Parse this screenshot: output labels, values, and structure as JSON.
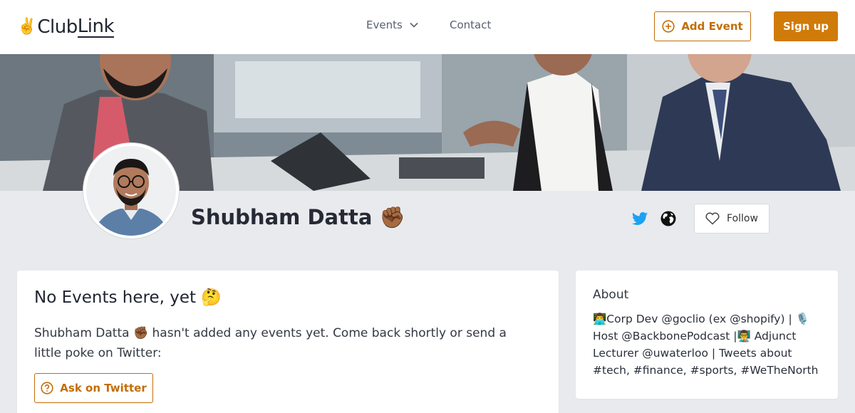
{
  "header": {
    "logo_emoji": "✌️",
    "logo_club": "Club",
    "logo_link": "Link",
    "nav_events": "Events",
    "nav_contact": "Contact",
    "add_event_label": "Add Event",
    "signup_label": "Sign up",
    "accent_color": "#d07a09"
  },
  "profile": {
    "name": "Shubham Datta ✊🏾",
    "follow_label": "Follow",
    "twitter_color": "#1da1f2"
  },
  "events": {
    "title": "No Events here, yet 🤔",
    "message": "Shubham Datta ✊🏾 hasn't added any events yet. Come back shortly or send a little poke on Twitter:",
    "ask_label": "Ask on Twitter"
  },
  "about": {
    "title": "About",
    "bio": "👨‍💻Corp Dev @goclio (ex @shopify) | 🎙️ Host @BackbonePodcast |👨‍🏫 Adjunct Lecturer @uwaterloo | Tweets about #tech, #finance, #sports, #WeTheNorth"
  }
}
